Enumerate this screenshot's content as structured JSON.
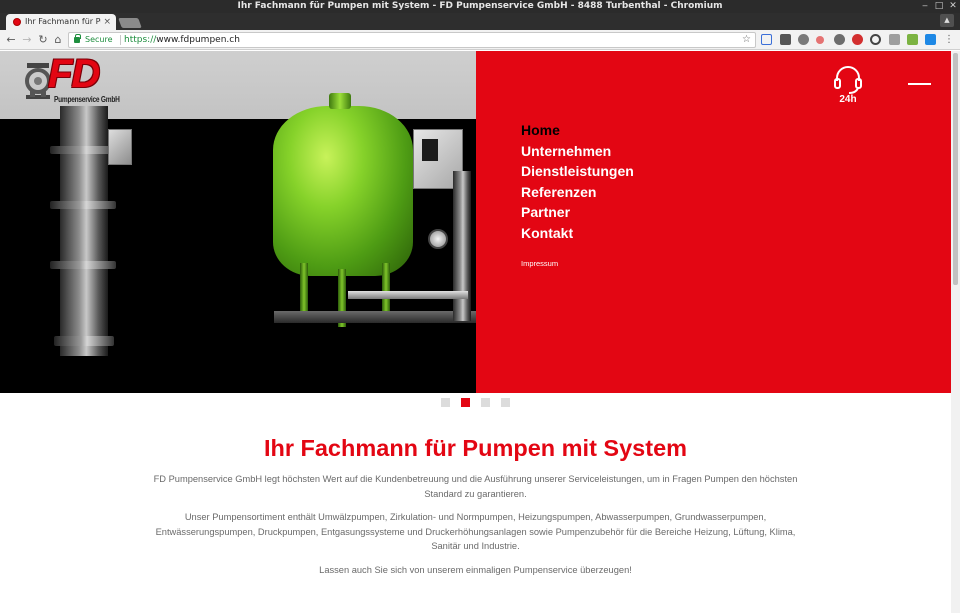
{
  "window": {
    "title": "Ihr Fachmann für Pumpen mit System - FD Pumpenservice GmbH - 8488 Turbenthal - Chromium",
    "minimize_glyph": "‒",
    "maximize_glyph": "□",
    "close_glyph": "✕"
  },
  "tab": {
    "label": "Ihr Fachmann für Pum",
    "close_glyph": "×"
  },
  "toolbar": {
    "secure_label": "Secure",
    "url_scheme": "https://",
    "url_host": "www.fdpumpen.ch",
    "back_glyph": "←",
    "forward_glyph": "→",
    "reload_glyph": "↻",
    "home_glyph": "⌂",
    "star_glyph": "☆"
  },
  "logo": {
    "mark": "FD",
    "company": "Pumpenservice GmbH"
  },
  "hotline": {
    "icon": "headset-icon",
    "label": "24h"
  },
  "menu": {
    "items": [
      {
        "label": "Home",
        "active": true
      },
      {
        "label": "Unternehmen",
        "active": false
      },
      {
        "label": "Dienstleistungen",
        "active": false
      },
      {
        "label": "Referenzen",
        "active": false
      },
      {
        "label": "Partner",
        "active": false
      },
      {
        "label": "Kontakt",
        "active": false
      }
    ],
    "impressum": "Impressum"
  },
  "slider": {
    "count": 4,
    "active_index": 1
  },
  "content": {
    "heading": "Ihr Fachmann für Pumpen mit System",
    "paragraph1": "FD Pumpenservice GmbH legt höchsten Wert auf die Kundenbetreuung und die Ausführung unserer Serviceleistungen, um in Fragen Pumpen den höchsten Standard zu garantieren.",
    "paragraph2": "Unser Pumpensortiment enthält Umwälzpumpen, Zirkulation- und Normpumpen, Heizungspumpen, Abwasserpumpen, Grundwasserpumpen, Entwässerungspumpen, Druckpumpen, Entgasungssysteme und Druckerhöhungsanlagen sowie Pumpenzubehör für die Bereiche Heizung, Lüftung, Klima, Sanitär und Industrie.",
    "paragraph3": "Lassen auch Sie sich von unserem einmaligen Pumpenservice überzeugen!"
  },
  "colors": {
    "brand_red": "#e30613",
    "active_menu": "#000000",
    "body_text": "#6a6a6a"
  }
}
